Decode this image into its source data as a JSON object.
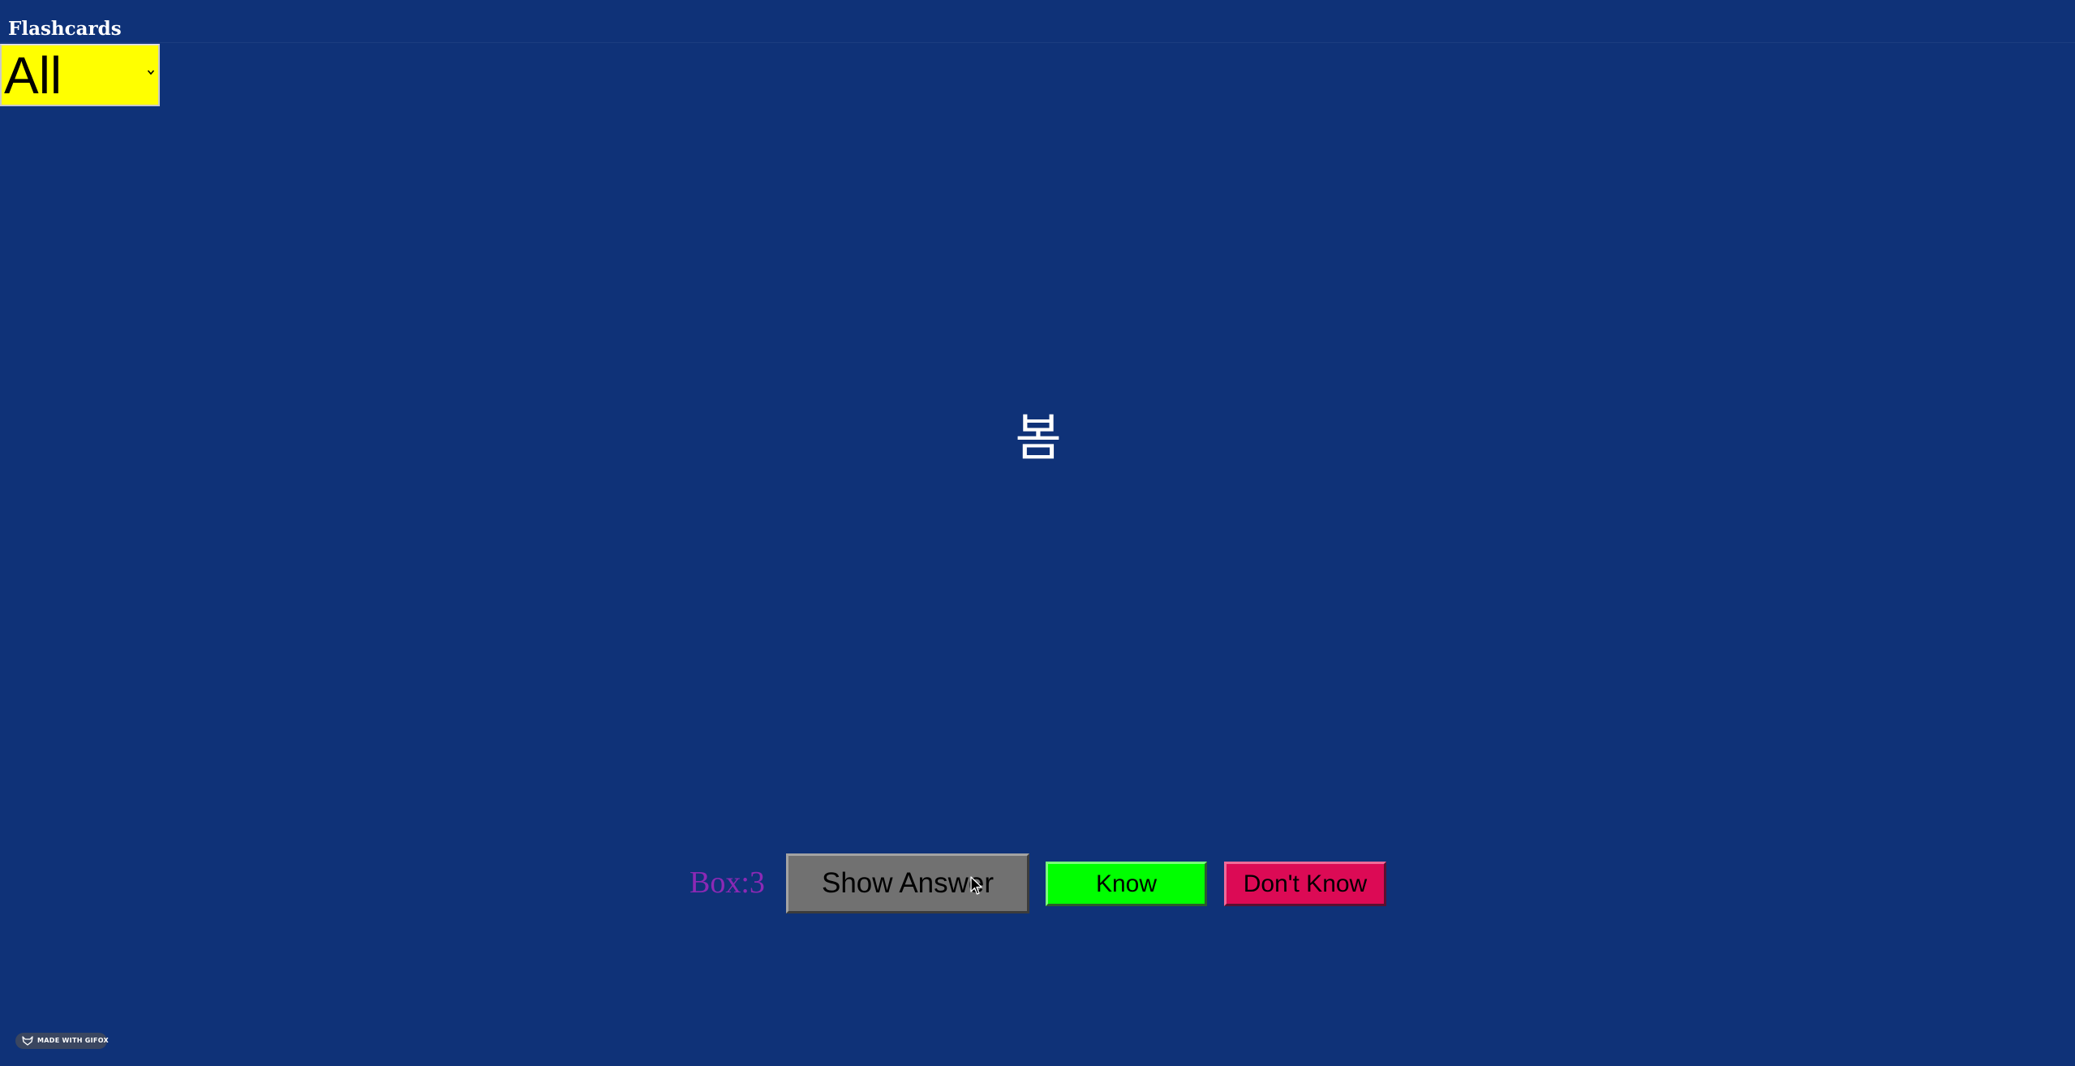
{
  "app": {
    "title": "Flashcards"
  },
  "deck_select": {
    "selected": "All",
    "icon": "chevron-down-icon"
  },
  "card": {
    "word": "봄"
  },
  "controls": {
    "box_label": "Box:3",
    "show_answer_label": "Show Answer",
    "know_label": "Know",
    "dont_know_label": "Don't Know"
  },
  "badge": {
    "text": "MADE WITH GIFOX",
    "icon": "fox-icon"
  },
  "colors": {
    "background": "#0f3278",
    "select_background": "#ffff00",
    "box_label": "#8c29b5",
    "show_answer_button": "#717171",
    "know_button": "#00ff00",
    "dont_know_button": "#dc0a55"
  }
}
